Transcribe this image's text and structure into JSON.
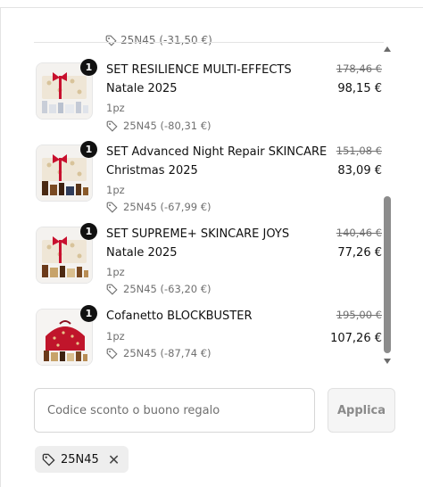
{
  "peek_item": {
    "discount": "25N45 (-31,50 €)"
  },
  "items": [
    {
      "qty_badge": "1",
      "title": "SET RESILIENCE MULTI-EFFECTS Natale 2025",
      "qty": "1pz",
      "discount": "25N45 (-80,31 €)",
      "old_price": "178,46 €",
      "new_price": "98,15 €"
    },
    {
      "qty_badge": "1",
      "title": "SET Advanced Night Repair SKINCARE Christmas 2025",
      "qty": "1pz",
      "discount": "25N45 (-67,99 €)",
      "old_price": "151,08 €",
      "new_price": "83,09 €"
    },
    {
      "qty_badge": "1",
      "title": "SET SUPREME+ SKINCARE JOYS Natale 2025",
      "qty": "1pz",
      "discount": "25N45 (-63,20 €)",
      "old_price": "140,46 €",
      "new_price": "77,26 €"
    },
    {
      "qty_badge": "1",
      "title": "Cofanetto BLOCKBUSTER",
      "qty": "1pz",
      "discount": "25N45 (-87,74 €)",
      "old_price": "195,00 €",
      "new_price": "107,26 €"
    }
  ],
  "discount_form": {
    "placeholder": "Codice sconto o buono regalo",
    "value": "",
    "apply_label": "Applica"
  },
  "applied_code": {
    "code": "25N45"
  },
  "icons": {
    "tag": "tag-icon",
    "remove": "close-icon",
    "scroll_up": "chevron-up-icon",
    "scroll_down": "chevron-down-icon"
  }
}
